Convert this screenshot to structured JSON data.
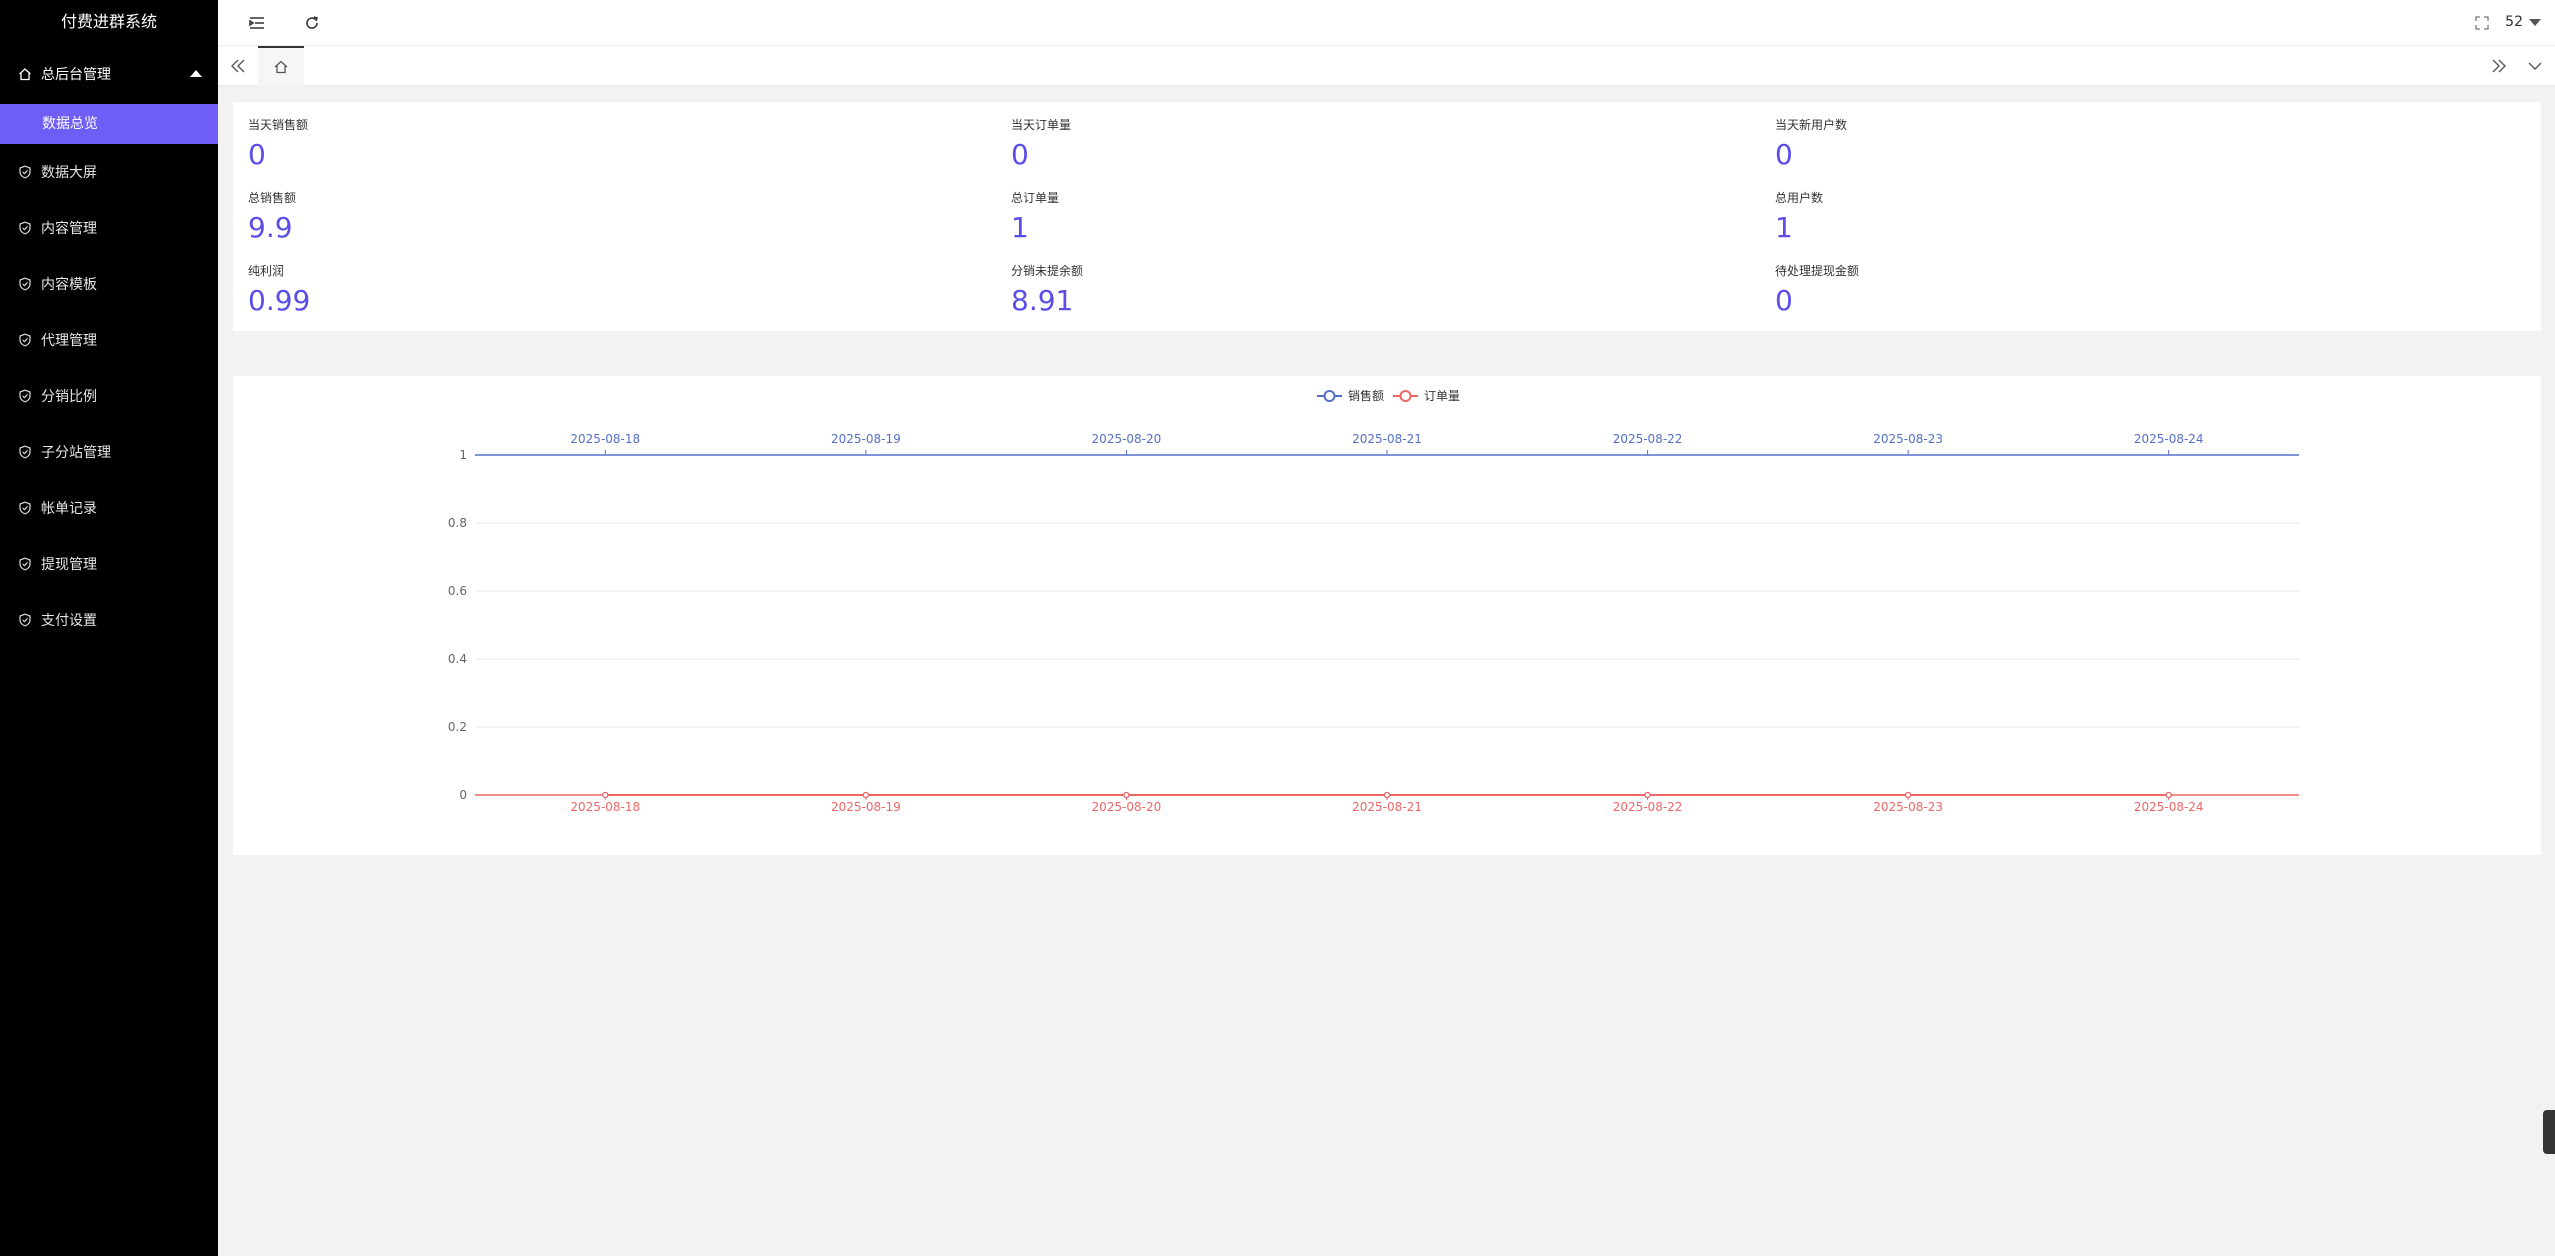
{
  "app": {
    "title": "付费进群系统"
  },
  "sidebar": {
    "group": {
      "label": "总后台管理",
      "icon": "home-icon"
    },
    "active_sub": "数据总览",
    "items": [
      {
        "label": "数据大屏",
        "icon": "shield-check-icon"
      },
      {
        "label": "内容管理",
        "icon": "shield-check-icon"
      },
      {
        "label": "内容模板",
        "icon": "shield-check-icon"
      },
      {
        "label": "代理管理",
        "icon": "shield-check-icon"
      },
      {
        "label": "分销比例",
        "icon": "shield-check-icon"
      },
      {
        "label": "子分站管理",
        "icon": "shield-check-icon"
      },
      {
        "label": "帐单记录",
        "icon": "shield-check-icon"
      },
      {
        "label": "提现管理",
        "icon": "shield-check-icon"
      },
      {
        "label": "支付设置",
        "icon": "shield-check-icon"
      }
    ]
  },
  "header": {
    "user": "52"
  },
  "stats": [
    {
      "label": "当天销售额",
      "value": "0"
    },
    {
      "label": "当天订单量",
      "value": "0"
    },
    {
      "label": "当天新用户数",
      "value": "0"
    },
    {
      "label": "总销售额",
      "value": "9.9"
    },
    {
      "label": "总订单量",
      "value": "1"
    },
    {
      "label": "总用户数",
      "value": "1"
    },
    {
      "label": "纯利润",
      "value": "0.99"
    },
    {
      "label": "分销未提余额",
      "value": "8.91"
    },
    {
      "label": "待处理提现金额",
      "value": "0"
    }
  ],
  "colors": {
    "accent": "#6f5ef5",
    "series_sales": "#5470c6",
    "series_orders": "#ee6666"
  },
  "chart_data": {
    "type": "line",
    "legend_position": "top-center",
    "categories": [
      "2025-08-18",
      "2025-08-19",
      "2025-08-20",
      "2025-08-21",
      "2025-08-22",
      "2025-08-23",
      "2025-08-24"
    ],
    "series": [
      {
        "name": "销售额",
        "values": [
          0,
          0,
          0,
          0,
          0,
          0,
          0
        ]
      },
      {
        "name": "订单量",
        "values": [
          0,
          0,
          0,
          0,
          0,
          0,
          0
        ]
      }
    ],
    "yticks": [
      "0",
      "0.2",
      "0.4",
      "0.6",
      "0.8",
      "1"
    ],
    "ylim": [
      0,
      1
    ],
    "grid": true
  }
}
